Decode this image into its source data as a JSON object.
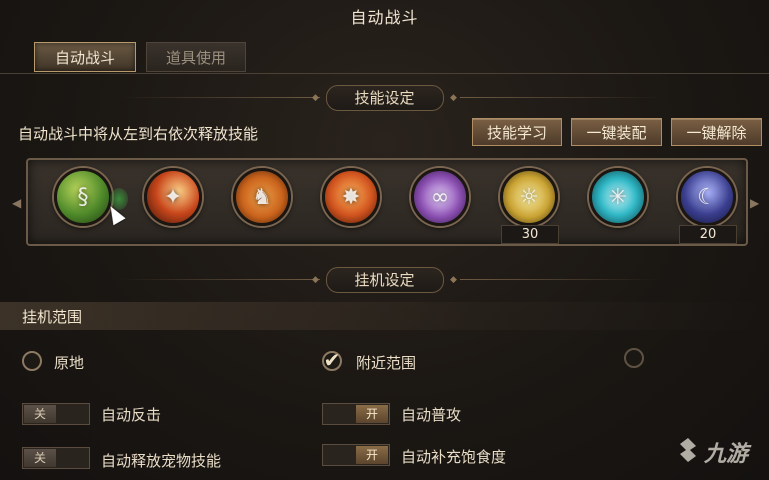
{
  "window": {
    "title": "自动战斗"
  },
  "tabs": [
    {
      "label": "自动战斗",
      "active": true
    },
    {
      "label": "道具使用",
      "active": false
    }
  ],
  "skill_section": {
    "header": "技能设定",
    "description": "自动战斗中将从左到右依次释放技能",
    "buttons": {
      "learn": "技能学习",
      "equip_all": "一键装配",
      "unequip_all": "一键解除"
    },
    "skills": [
      {
        "icon": "serpent-skill-icon",
        "color": "#4f8a2a",
        "count": ""
      },
      {
        "icon": "fire-slash-skill-icon",
        "color": "#c7461b",
        "count": ""
      },
      {
        "icon": "flame-warrior-skill-icon",
        "color": "#c9631c",
        "count": ""
      },
      {
        "icon": "fire-burst-skill-icon",
        "color": "#d0531e",
        "count": ""
      },
      {
        "icon": "chain-magic-skill-icon",
        "color": "#8a4fb0",
        "count": ""
      },
      {
        "icon": "gold-seal-skill-icon",
        "color": "#c9a233",
        "count": "30"
      },
      {
        "icon": "frost-star-skill-icon",
        "color": "#2fb6c4",
        "count": ""
      },
      {
        "icon": "shadow-mage-skill-icon",
        "color": "#3b3f8f",
        "count": "20"
      }
    ]
  },
  "idle_section": {
    "header": "挂机设定",
    "range_title": "挂机范围",
    "range_options": [
      {
        "label": "原地",
        "selected": false
      },
      {
        "label": "附近范围",
        "selected": true
      }
    ],
    "toggles": [
      {
        "label": "自动反击",
        "state_text": "关",
        "on": false
      },
      {
        "label": "自动普攻",
        "state_text": "开",
        "on": true
      },
      {
        "label": "自动释放宠物技能",
        "state_text": "关",
        "on": false
      },
      {
        "label": "自动补充饱食度",
        "state_text": "开",
        "on": true
      }
    ]
  },
  "watermark": {
    "text": "九游",
    "icon": "jiuyou-logo-icon"
  }
}
